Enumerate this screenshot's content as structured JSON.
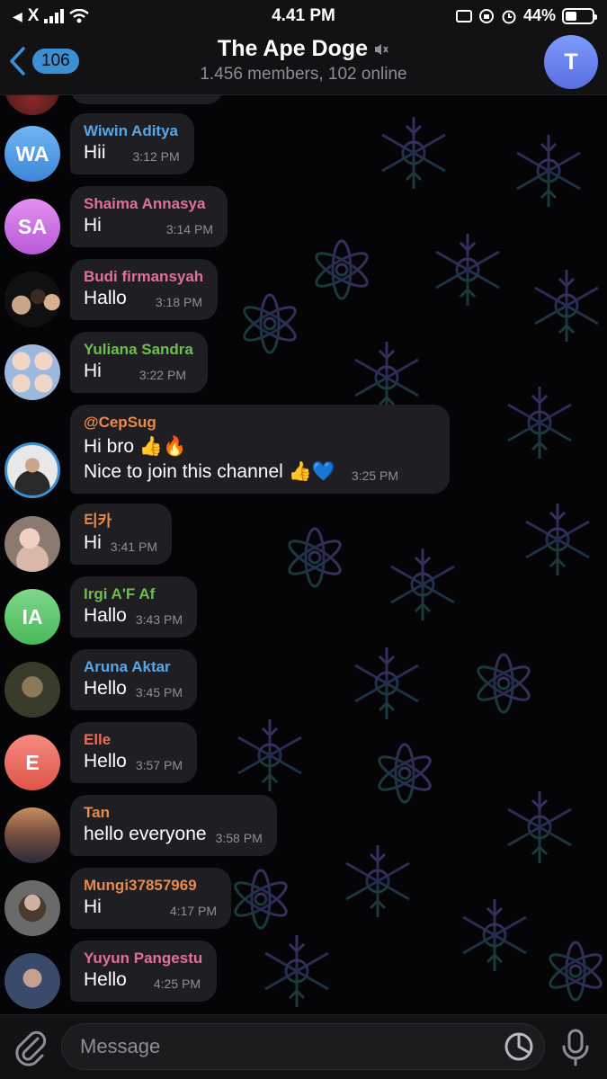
{
  "status_bar": {
    "back_app": "X",
    "time": "4.41 PM",
    "battery": "44%",
    "battery_level": 0.44
  },
  "header": {
    "back_count": "106",
    "title": "The Ape Doge",
    "subtitle": "1.456 members, 102 online",
    "avatar_initial": "T"
  },
  "messages": [
    {
      "sender": "Wiwin Aditya",
      "text": "Hii",
      "time": "3:12 PM",
      "initials": "WA"
    },
    {
      "sender": "Shaima Annasya",
      "text": "Hi",
      "time": "3:14 PM",
      "initials": "SA"
    },
    {
      "sender": "Budi firmansyah",
      "text": "Hallo",
      "time": "3:18 PM"
    },
    {
      "sender": "Yuliana Sandra",
      "text": "Hi",
      "time": "3:22 PM"
    },
    {
      "sender": "@CepSug",
      "line1": "Hi bro 👍🔥",
      "line2": "Nice to join this channel 👍💙",
      "time": "3:25 PM"
    },
    {
      "sender": "티카",
      "text": "Hi",
      "time": "3:41 PM"
    },
    {
      "sender": "Irgi A'F Af",
      "text": "Hallo",
      "time": "3:43 PM",
      "initials": "IA"
    },
    {
      "sender": "Aruna Aktar",
      "text": "Hello",
      "time": "3:45 PM"
    },
    {
      "sender": "Elle",
      "text": "Hello",
      "time": "3:57 PM",
      "initials": "E"
    },
    {
      "sender": "Tan",
      "text": "hello everyone",
      "time": "3:58 PM"
    },
    {
      "sender": "Mungi37857969",
      "text": "Hi",
      "time": "4:17 PM"
    },
    {
      "sender": "Yuyun Pangestu",
      "text": "Hello",
      "time": "4:25 PM"
    }
  ],
  "input": {
    "placeholder": "Message"
  },
  "colors": {
    "accent": "#3b8fd3",
    "bubble": "#1f1f23",
    "name_blue": "#5aa7e6",
    "name_pink": "#e0709a",
    "name_green": "#6cc04a",
    "name_orange": "#e88a4c",
    "name_red": "#ef6a5a"
  }
}
